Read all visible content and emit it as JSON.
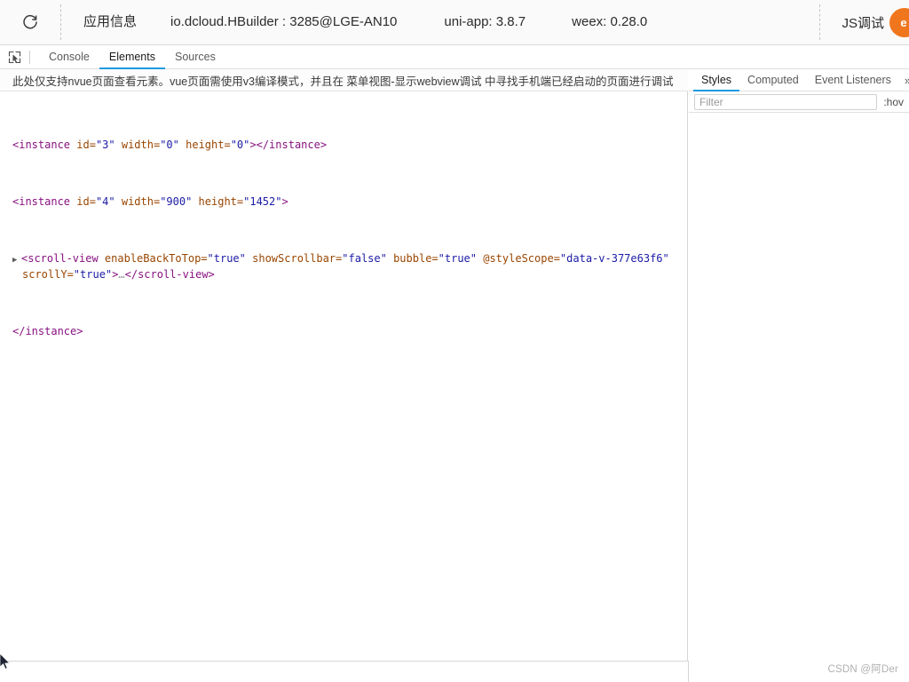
{
  "appbar": {
    "reload_icon": "reload-icon",
    "items": [
      {
        "label": "应用信息",
        "name": "app-info"
      },
      {
        "label": "io.dcloud.HBuilder : 3285@LGE-AN10",
        "name": "app-package-device"
      },
      {
        "label": "uni-app: 3.8.7",
        "name": "uniapp-version"
      },
      {
        "label": "weex: 0.28.0",
        "name": "weex-version"
      }
    ],
    "js_debug_label": "JS调试",
    "action_button": {
      "glyph": "e",
      "color": "#f0761e",
      "name": "account-avatar-button"
    }
  },
  "devtools": {
    "inspect_icon": "inspect-element-icon",
    "tabs": [
      {
        "label": "Console",
        "active": false
      },
      {
        "label": "Elements",
        "active": true
      },
      {
        "label": "Sources",
        "active": false
      }
    ],
    "notice": "此处仅支持nvue页面查看元素。vue页面需使用v3编译模式，并且在 菜单视图-显示webview调试 中寻找手机端已经启动的页面进行调试",
    "tree": {
      "line1": {
        "tag_open": "<instance",
        "attrs": [
          {
            "name": " id=",
            "value": "\"3\""
          },
          {
            "name": " width=",
            "value": "\"0\""
          },
          {
            "name": " height=",
            "value": "\"0\""
          }
        ],
        "tag_close": ">",
        "end_tag": "</instance>"
      },
      "line2": {
        "tag_open": "<instance",
        "attrs": [
          {
            "name": " id=",
            "value": "\"4\""
          },
          {
            "name": " width=",
            "value": "\"900\""
          },
          {
            "name": " height=",
            "value": "\"1452\""
          }
        ],
        "tag_close": ">"
      },
      "line3": {
        "toggle": "▶",
        "tag_open": "<scroll-view",
        "attrs": [
          {
            "name": " enableBackToTop=",
            "value": "\"true\""
          },
          {
            "name": " showScrollbar=",
            "value": "\"false\""
          },
          {
            "name": " bubble=",
            "value": "\"true\""
          },
          {
            "name": " @styleScope=",
            "value": "\"data-v-377e63f6\""
          },
          {
            "name": " scrollY=",
            "value": "\"true\""
          }
        ],
        "tag_close": ">",
        "ellipsis": "…",
        "end_tag": "</scroll-view>"
      },
      "line4": {
        "end_tag": "</instance>"
      }
    }
  },
  "styles_panel": {
    "tabs": [
      {
        "label": "Styles",
        "active": true
      },
      {
        "label": "Computed",
        "active": false
      },
      {
        "label": "Event Listeners",
        "active": false
      }
    ],
    "more_label": "»",
    "filter_placeholder": "Filter",
    "filter_value": "",
    "hov_label": ":hov"
  },
  "watermark": "CSDN @阿Der"
}
